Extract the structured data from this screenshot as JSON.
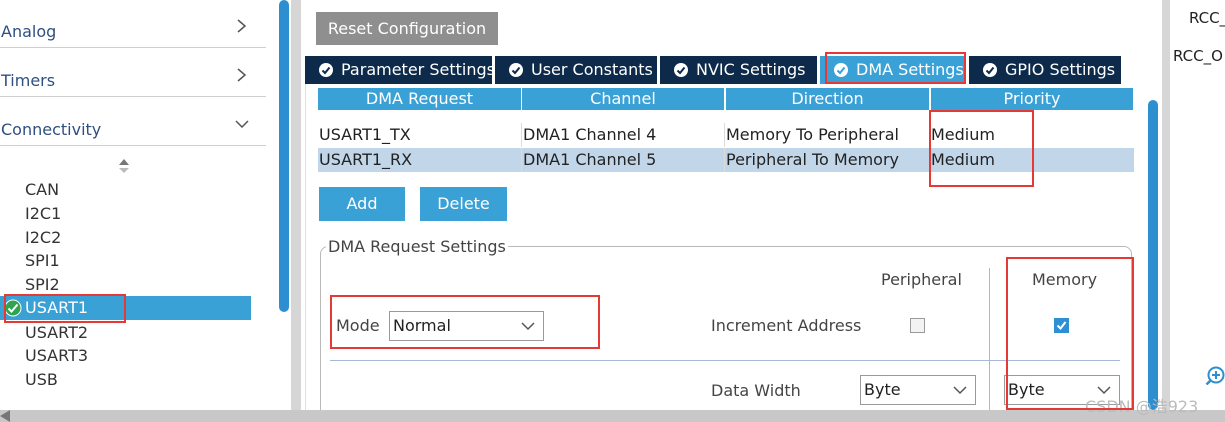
{
  "categories": [
    {
      "label": "Analog",
      "state": "collapsed"
    },
    {
      "label": "Timers",
      "state": "collapsed"
    },
    {
      "label": "Connectivity",
      "state": "expanded"
    }
  ],
  "peripherals": [
    "CAN",
    "I2C1",
    "I2C2",
    "SPI1",
    "SPI2",
    "USART1",
    "USART2",
    "USART3",
    "USB"
  ],
  "selected_peripheral": "USART1",
  "reset_button": "Reset Configuration",
  "tabs": [
    {
      "label": "Parameter Settings",
      "active": false
    },
    {
      "label": "User Constants",
      "active": false
    },
    {
      "label": "NVIC Settings",
      "active": false
    },
    {
      "label": "DMA Settings",
      "active": true
    },
    {
      "label": "GPIO Settings",
      "active": false
    }
  ],
  "dma_table": {
    "columns": [
      "DMA Request",
      "Channel",
      "Direction",
      "Priority"
    ],
    "rows": [
      [
        "USART1_TX",
        "DMA1 Channel 4",
        "Memory To Peripheral",
        "Medium"
      ],
      [
        "USART1_RX",
        "DMA1 Channel 5",
        "Peripheral To Memory",
        "Medium"
      ]
    ],
    "selected_row": 1
  },
  "buttons": {
    "add": "Add",
    "delete": "Delete"
  },
  "request_settings": {
    "title": "DMA Request Settings",
    "mode_label": "Mode",
    "mode_value": "Normal",
    "col_peripheral": "Peripheral",
    "col_memory": "Memory",
    "increment_label": "Increment Address",
    "increment_peripheral": false,
    "increment_memory": true,
    "data_width_label": "Data Width",
    "data_width_peripheral": "Byte",
    "data_width_memory": "Byte"
  },
  "right_panel": {
    "line1": "RCC_",
    "line2": "RCC_O"
  },
  "watermark": "CSDN @浩923",
  "colors": {
    "accent": "#3aa1d6",
    "tab_dark": "#0d2a4a",
    "selected_row": "#c2d6ea",
    "highlight": "#e53935",
    "reset_button": "#8f8f8f"
  }
}
